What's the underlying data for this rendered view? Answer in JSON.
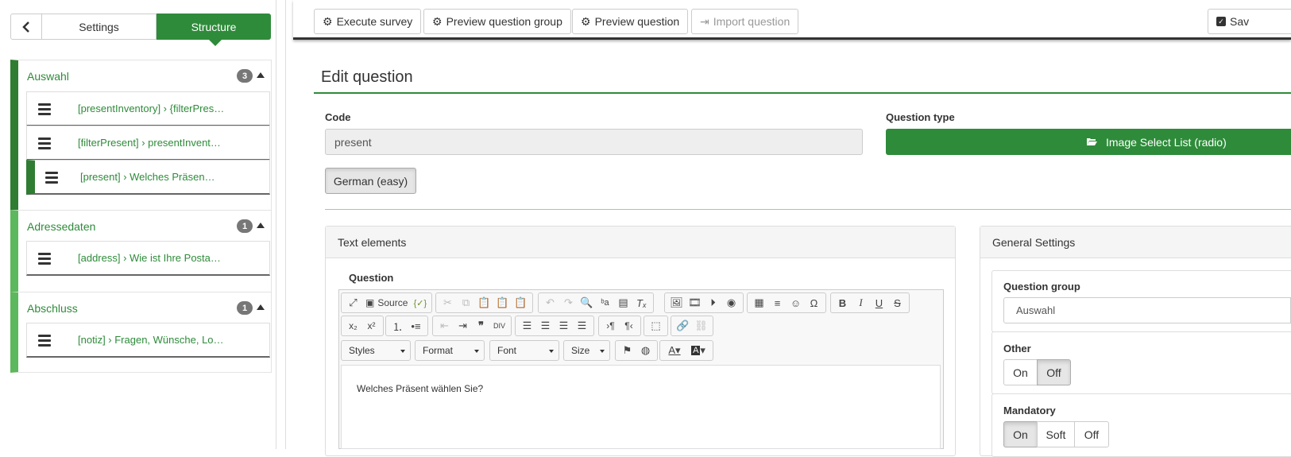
{
  "sidebar": {
    "tabs": {
      "settings": "Settings",
      "structure": "Structure"
    },
    "groups": [
      {
        "title": "Auswahl",
        "count": "3",
        "questions": [
          "[presentInventory] › {filterPres…",
          "[filterPresent] › presentInvent…",
          "[present] › Welches Präsen…"
        ]
      },
      {
        "title": "Adressedaten",
        "count": "1",
        "questions": [
          "[address] › Wie ist Ihre Posta…"
        ]
      },
      {
        "title": "Abschluss",
        "count": "1",
        "questions": [
          "[notiz] › Fragen, Wünsche, Lo…"
        ]
      }
    ]
  },
  "toolbar": {
    "execute_survey": "Execute survey",
    "preview_group": "Preview question group",
    "preview_question": "Preview question",
    "import_question": "Import question",
    "save": "Sav"
  },
  "main": {
    "title": "Edit question",
    "code_label": "Code",
    "code_value": "present",
    "qtype_label": "Question type",
    "qtype_value": "Image Select List (radio)",
    "language": "German (easy)",
    "text_elements": {
      "heading": "Text elements",
      "question_label": "Question",
      "source_label": "Source",
      "combos": {
        "styles": "Styles",
        "format": "Format",
        "font": "Font",
        "size": "Size"
      },
      "question_text": "Welches Präsent wählen Sie?"
    },
    "general_settings": {
      "heading": "General Settings",
      "question_group_label": "Question group",
      "question_group_value": "Auswahl",
      "other_label": "Other",
      "other_on": "On",
      "other_off": "Off",
      "other_value": "Off",
      "mandatory_label": "Mandatory",
      "mandatory_on": "On",
      "mandatory_soft": "Soft",
      "mandatory_off": "Off"
    }
  },
  "colors": {
    "accent": "#2e8b3a",
    "accent_dark": "#2e7d32",
    "accent_light": "#5cb85c"
  }
}
